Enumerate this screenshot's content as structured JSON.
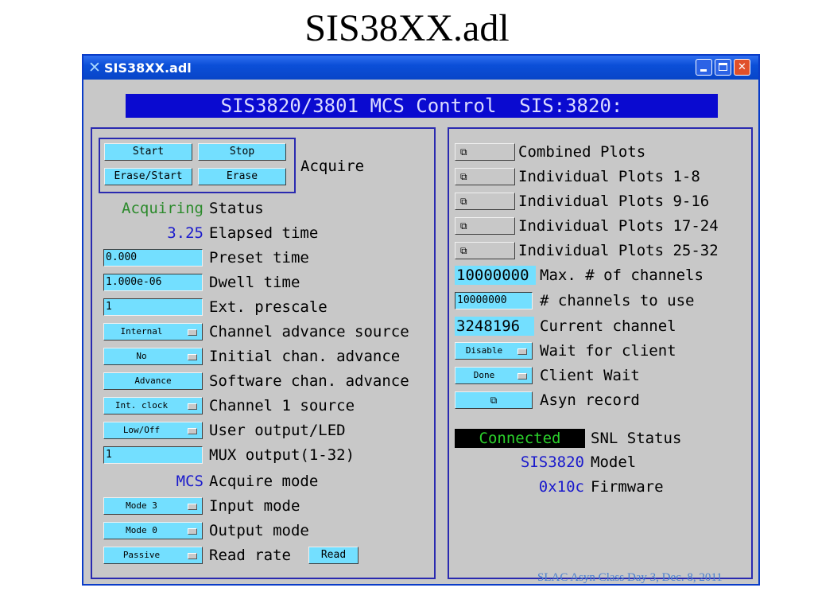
{
  "slide_title": "SIS38XX.adl",
  "window": {
    "title": "SIS38XX.adl",
    "banner": "SIS3820/3801 MCS Control  SIS:3820:"
  },
  "colors": {
    "button_bg": "#73dfff",
    "panel_bg": "#c8c8c8",
    "banner_bg": "#0a0ad0",
    "status_green": "#2b8a2b",
    "value_blue": "#1a1acc",
    "snl_bg": "#000000",
    "snl_text": "#2bd12b"
  },
  "acquire": {
    "start": "Start",
    "stop": "Stop",
    "erase_start": "Erase/Start",
    "erase": "Erase",
    "label": "Acquire"
  },
  "left": {
    "status": {
      "value": "Acquiring",
      "label": "Status"
    },
    "elapsed": {
      "value": "3.25",
      "label": "Elapsed time"
    },
    "preset": {
      "value": "0.000",
      "label": "Preset time"
    },
    "dwell": {
      "value": "1.000e-06",
      "label": "Dwell time"
    },
    "prescale": {
      "value": "1",
      "label": "Ext. prescale"
    },
    "chan_adv_source": {
      "value": "Internal",
      "label": "Channel advance source"
    },
    "initial_adv": {
      "value": "No",
      "label": "Initial chan. advance"
    },
    "software_adv": {
      "value": "Advance",
      "label": "Software chan. advance"
    },
    "chan1_source": {
      "value": "Int. clock",
      "label": "Channel 1 source"
    },
    "user_output": {
      "value": "Low/Off",
      "label": "User output/LED"
    },
    "mux_output": {
      "value": "1",
      "label": "MUX output(1-32)"
    },
    "acquire_mode": {
      "value": "MCS",
      "label": "Acquire mode"
    },
    "input_mode": {
      "value": "Mode 3",
      "label": "Input mode"
    },
    "output_mode": {
      "value": "Mode 0",
      "label": "Output mode"
    },
    "read_rate": {
      "value": "Passive",
      "label": "Read rate",
      "read_button": "Read"
    }
  },
  "right": {
    "plots": [
      "Combined Plots",
      "Individual Plots 1-8",
      "Individual Plots 9-16",
      "Individual Plots 17-24",
      "Individual Plots 25-32"
    ],
    "max_channels": {
      "value": "10000000",
      "label": "Max. # of channels"
    },
    "use_channels": {
      "value": "10000000",
      "label": "# channels to use"
    },
    "current_channel": {
      "value": "3248196",
      "label": "Current channel"
    },
    "wait_for_client": {
      "value": "Disable",
      "label": "Wait for client"
    },
    "client_wait": {
      "value": "Done",
      "label": "Client Wait"
    },
    "asyn_record": {
      "label": "Asyn record"
    },
    "snl_status": {
      "value": "Connected",
      "label": "SNL Status"
    },
    "model": {
      "value": "SIS3820",
      "label": "Model"
    },
    "firmware": {
      "value": "0x10c",
      "label": "Firmware"
    }
  },
  "footer": "SLAC Asyn Class Day 3, Dec. 8, 2011",
  "icons": [
    "window-app-icon",
    "minimize-icon",
    "maximize-icon",
    "close-icon",
    "related-display-icon",
    "menu-indicator-icon"
  ]
}
